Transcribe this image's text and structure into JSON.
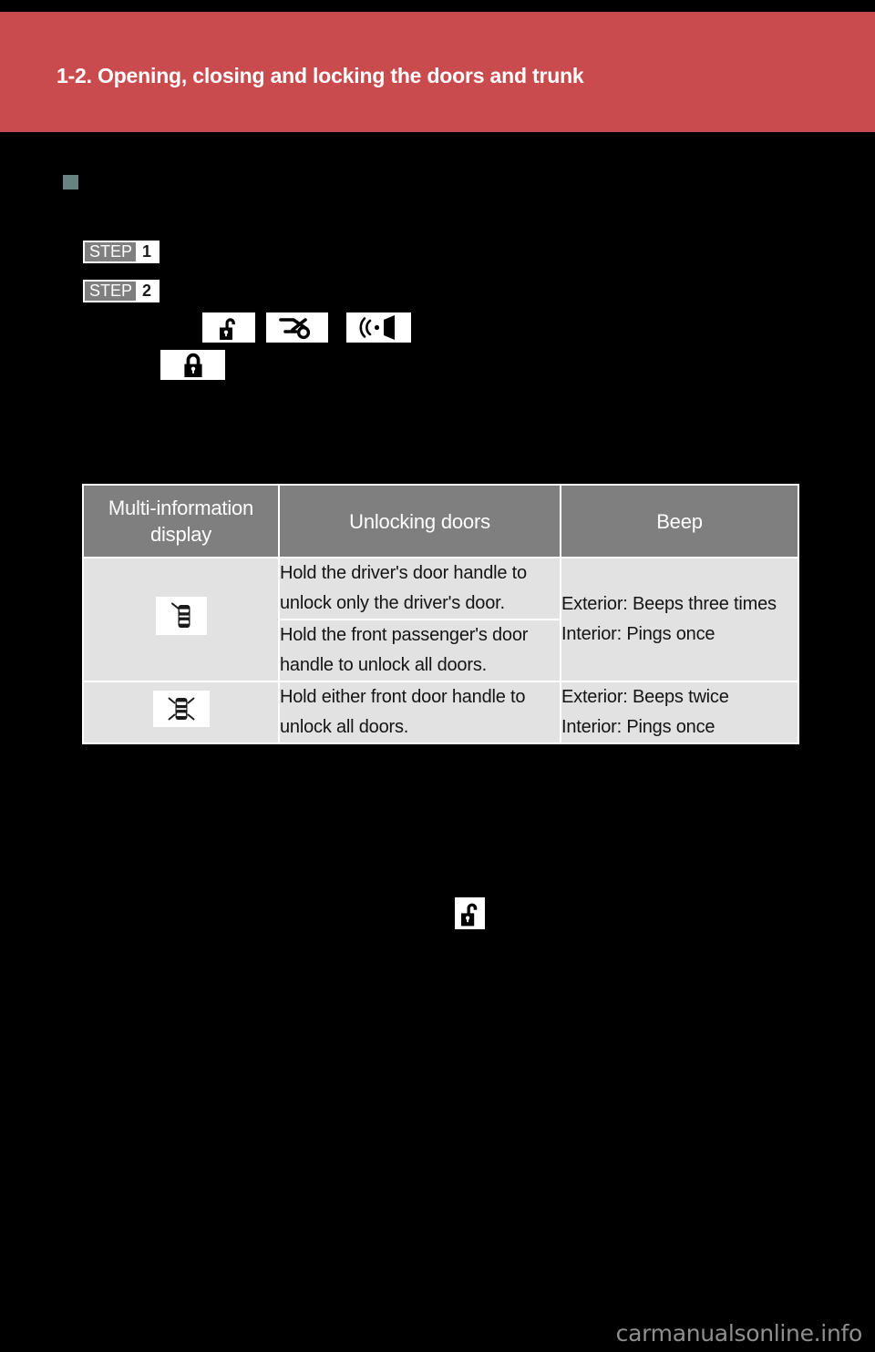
{
  "page": {
    "background_color": "#000000",
    "header_color": "#c94b4d",
    "bullet_color": "#688282",
    "table_header_color": "#7f7f7f",
    "table_body_color": "#e2e2e2",
    "watermark_color": "#8f8f8f"
  },
  "header": {
    "chapter_title": "1-2. Opening, closing and locking the doors and trunk"
  },
  "steps": [
    {
      "word": "STEP",
      "number": "1"
    },
    {
      "word": "STEP",
      "number": "2"
    }
  ],
  "inline_icons": [
    {
      "name": "unlock-padlock-icon"
    },
    {
      "name": "key-icon"
    },
    {
      "name": "beep-speaker-icon"
    },
    {
      "name": "lock-padlock-icon"
    },
    {
      "name": "unlock-padlock-icon"
    }
  ],
  "table": {
    "columns": [
      "Multi-information display",
      "Unlocking doors",
      "Beep"
    ],
    "rows": [
      {
        "display_icon": "car-driver-door-unlock-icon",
        "unlocking_doors": [
          "Hold the driver's door handle to unlock only the driver's door.",
          "Hold the front passenger's door handle to unlock all doors."
        ],
        "beep": "Exterior: Beeps three times\nInterior: Pings once"
      },
      {
        "display_icon": "car-all-doors-unlock-icon",
        "unlocking_doors": [
          "Hold either front door handle to unlock all doors."
        ],
        "beep": "Exterior: Beeps twice\nInterior: Pings once"
      }
    ]
  },
  "footer": {
    "watermark": "carmanualsonline.info"
  }
}
